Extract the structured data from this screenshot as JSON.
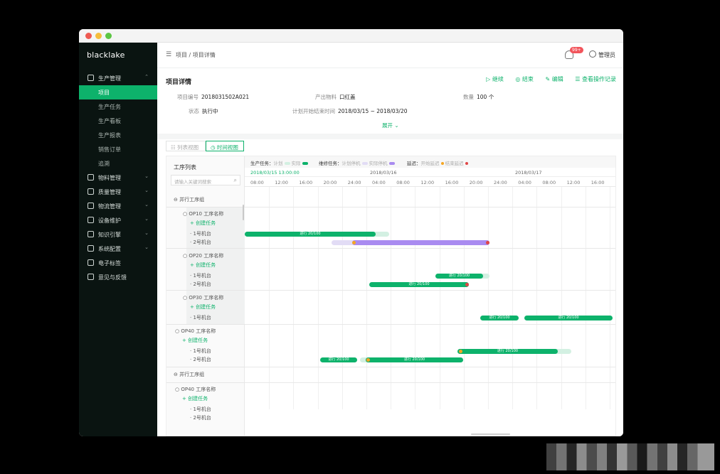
{
  "brand": "blacklake",
  "sidebar": {
    "groups": [
      {
        "label": "生产管理",
        "icon": "production-icon",
        "expanded": true,
        "items": [
          {
            "label": "项目",
            "active": true
          },
          {
            "label": "生产任务"
          },
          {
            "label": "生产看板"
          },
          {
            "label": "生产报表"
          },
          {
            "label": "销售订单"
          },
          {
            "label": "追溯"
          }
        ]
      },
      {
        "label": "物料管理",
        "icon": "material-icon"
      },
      {
        "label": "质量管理",
        "icon": "quality-icon"
      },
      {
        "label": "物流管理",
        "icon": "logistics-icon"
      },
      {
        "label": "设备维护",
        "icon": "equipment-icon"
      },
      {
        "label": "知识引擎",
        "icon": "knowledge-icon"
      },
      {
        "label": "系统配置",
        "icon": "settings-icon"
      },
      {
        "label": "电子标签",
        "icon": "tag-icon"
      },
      {
        "label": "意见与反馈",
        "icon": "feedback-icon"
      }
    ]
  },
  "topbar": {
    "breadcrumb": "项目 / 项目详情",
    "notification_badge": "99+",
    "user": "管理员"
  },
  "page": {
    "title": "项目详情",
    "actions": [
      "▷ 继续",
      "◎ 结束",
      "✎ 编辑",
      "☰ 查看操作记录"
    ],
    "fields": {
      "project_no_label": "项目编号",
      "project_no": "2018031502A021",
      "output_label": "产出物料",
      "output": "口红盖",
      "qty_label": "数量",
      "qty": "100 个",
      "status_label": "状态",
      "status": "执行中",
      "plan_label": "计划开始结束时间",
      "plan": "2018/03/15 ~ 2018/03/20"
    },
    "expand": "展开 ⌄",
    "view_tabs": {
      "list": "☷ 列表视图",
      "time": "◷ 时间视图"
    }
  },
  "gantt": {
    "left_title": "工序列表",
    "search_placeholder": "请输入关键词搜索",
    "rows": {
      "g1": "⊖ 并行工序组",
      "op10": "○ OP10 工序名称",
      "op10_create": "+ 创建任务",
      "op10_m1": "· 1号机台",
      "op10_m2": "· 2号机台",
      "op20": "○ OP20 工序名称",
      "op20_create": "+ 创建任务",
      "op20_m1": "· 1号机台",
      "op20_m2": "· 2号机台",
      "op30": "○ OP30 工序名称",
      "op30_create": "+ 创建任务",
      "op30_m1": "· 1号机台",
      "op40": "○ OP40 工序名称",
      "op40_create": "+ 创建任务",
      "op40_m1": "· 1号机台",
      "op40_m2": "· 2号机台",
      "g2": "⊖ 并行工序组",
      "op40b": "○ OP40 工序名称",
      "op40b_create": "+ 创建任务",
      "op40b_m1": "· 1号机台",
      "op40b_m2": "· 2号机台"
    },
    "legend": {
      "prod": "生产任务：",
      "plan": "计划",
      "actual": "实际",
      "maint": "维修任务：",
      "maint_plan": "计划停机",
      "maint_actual": "实际停机",
      "delay": "延迟：",
      "start_delay": "开始延迟",
      "end_delay": "结束延迟"
    },
    "dates": {
      "d1": "2018/03/15 13:00:00",
      "d2": "2018/03/16",
      "d3": "2018/03/17"
    },
    "times": [
      "08:00",
      "12:00",
      "16:00",
      "20:00",
      "24:00",
      "04:00",
      "08:00",
      "12:00",
      "16:00",
      "20:00",
      "24:00",
      "04:00",
      "08:00",
      "12:00",
      "16:00"
    ],
    "bar_label": "进行 20/100",
    "colors": {
      "accent": "#0db26b",
      "plan": "#d3f0e2",
      "maint": "#a98bf0",
      "start_delay": "#f5a623",
      "end_delay": "#e04646"
    }
  }
}
